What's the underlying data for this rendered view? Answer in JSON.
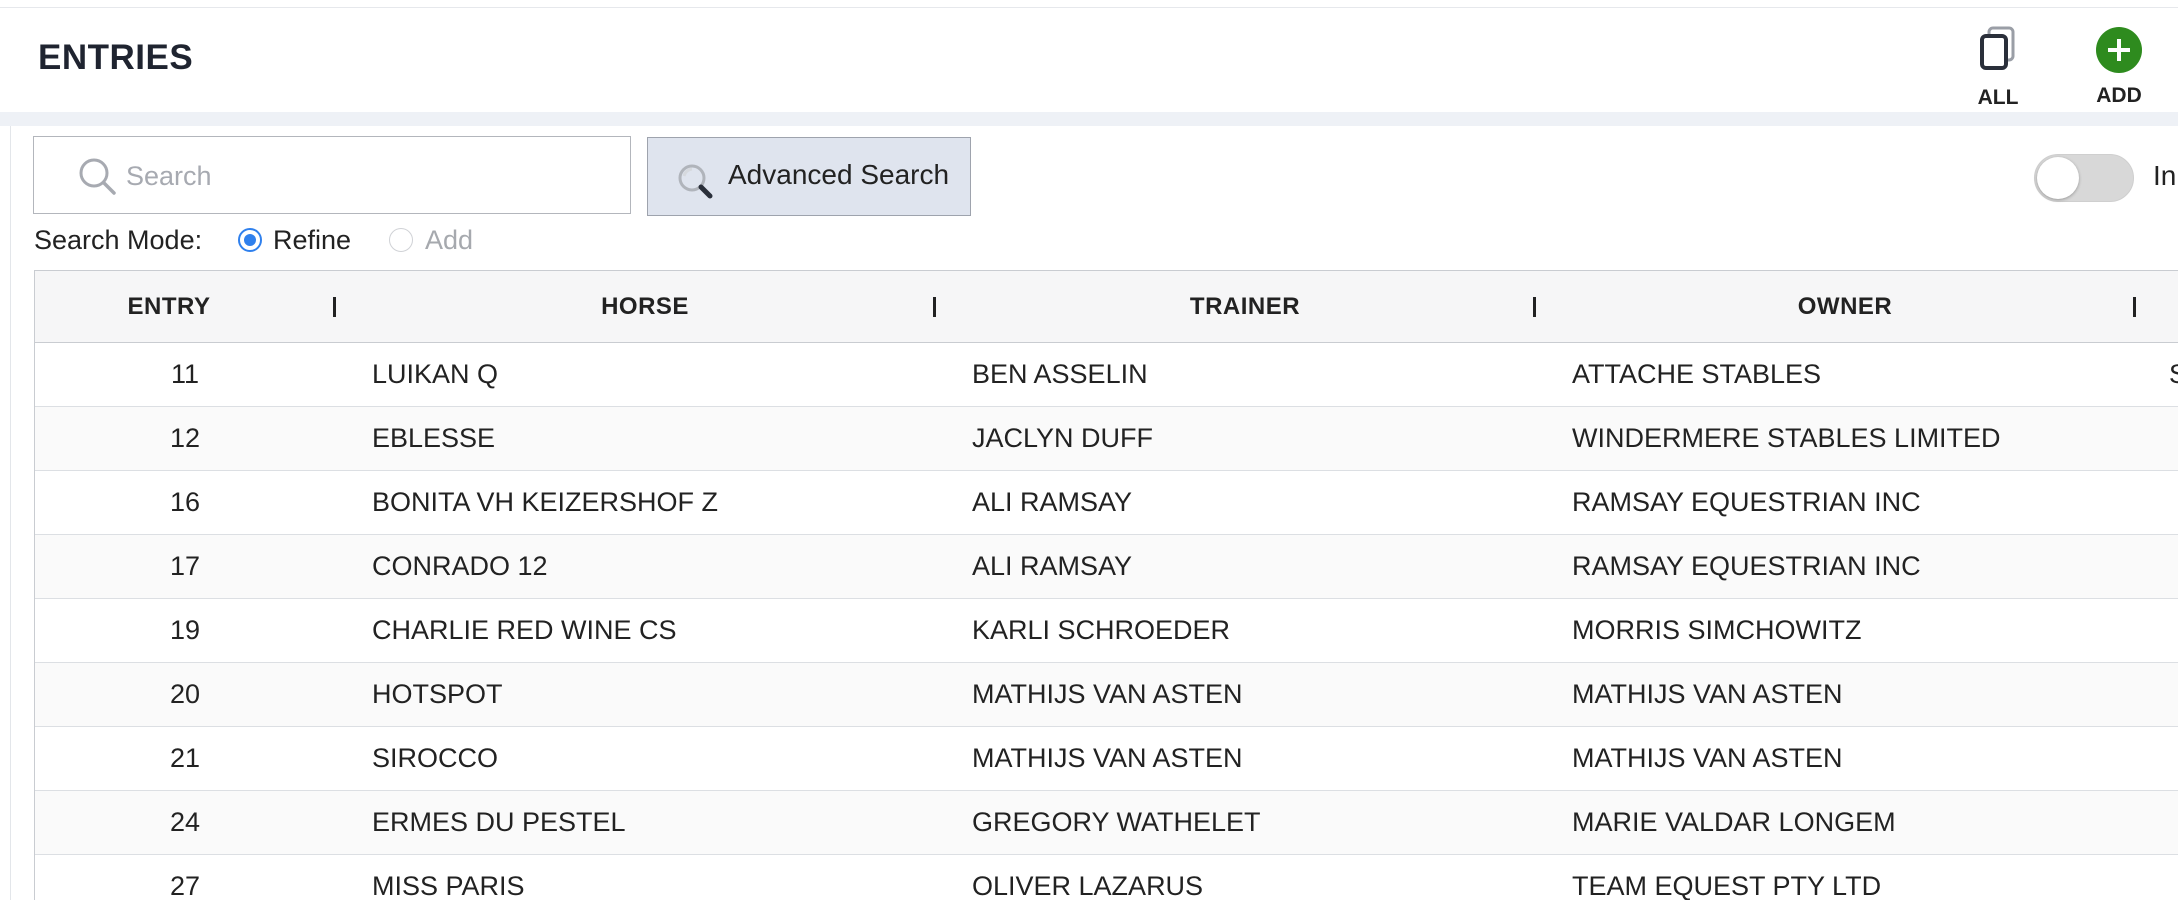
{
  "header": {
    "title": "ENTRIES",
    "all_label": "ALL",
    "add_label": "ADD",
    "add_color": "#2e8b1e"
  },
  "search": {
    "placeholder": "Search",
    "advanced_label": "Advanced Search"
  },
  "toggle": {
    "label_partial": "In",
    "state": "off"
  },
  "search_mode": {
    "label": "Search Mode:",
    "options": [
      {
        "label": "Refine",
        "selected": true
      },
      {
        "label": "Add",
        "selected": false,
        "disabled": true
      }
    ]
  },
  "table": {
    "columns": [
      "ENTRY",
      "HORSE",
      "TRAINER",
      "OWNER"
    ],
    "rows": [
      {
        "entry": "11",
        "horse": "LUIKAN Q",
        "trainer": "BEN ASSELIN",
        "owner": "ATTACHE STABLES",
        "extra": "S"
      },
      {
        "entry": "12",
        "horse": "EBLESSE",
        "trainer": "JACLYN DUFF",
        "owner": "WINDERMERE STABLES LIMITED",
        "extra": ""
      },
      {
        "entry": "16",
        "horse": "BONITA VH KEIZERSHOF Z",
        "trainer": "ALI RAMSAY",
        "owner": "RAMSAY EQUESTRIAN INC",
        "extra": ""
      },
      {
        "entry": "17",
        "horse": "CONRADO 12",
        "trainer": "ALI RAMSAY",
        "owner": "RAMSAY EQUESTRIAN INC",
        "extra": ""
      },
      {
        "entry": "19",
        "horse": "CHARLIE RED WINE CS",
        "trainer": "KARLI SCHROEDER",
        "owner": "MORRIS SIMCHOWITZ",
        "extra": ""
      },
      {
        "entry": "20",
        "horse": "HOTSPOT",
        "trainer": "MATHIJS VAN ASTEN",
        "owner": "MATHIJS VAN ASTEN",
        "extra": ""
      },
      {
        "entry": "21",
        "horse": "SIROCCO",
        "trainer": "MATHIJS VAN ASTEN",
        "owner": "MATHIJS VAN ASTEN",
        "extra": ""
      },
      {
        "entry": "24",
        "horse": "ERMES DU PESTEL",
        "trainer": "GREGORY WATHELET",
        "owner": "MARIE VALDAR LONGEM",
        "extra": ""
      },
      {
        "entry": "27",
        "horse": "MISS PARIS",
        "trainer": "OLIVER LAZARUS",
        "owner": "TEAM EQUEST PTY LTD",
        "extra": ""
      }
    ]
  }
}
